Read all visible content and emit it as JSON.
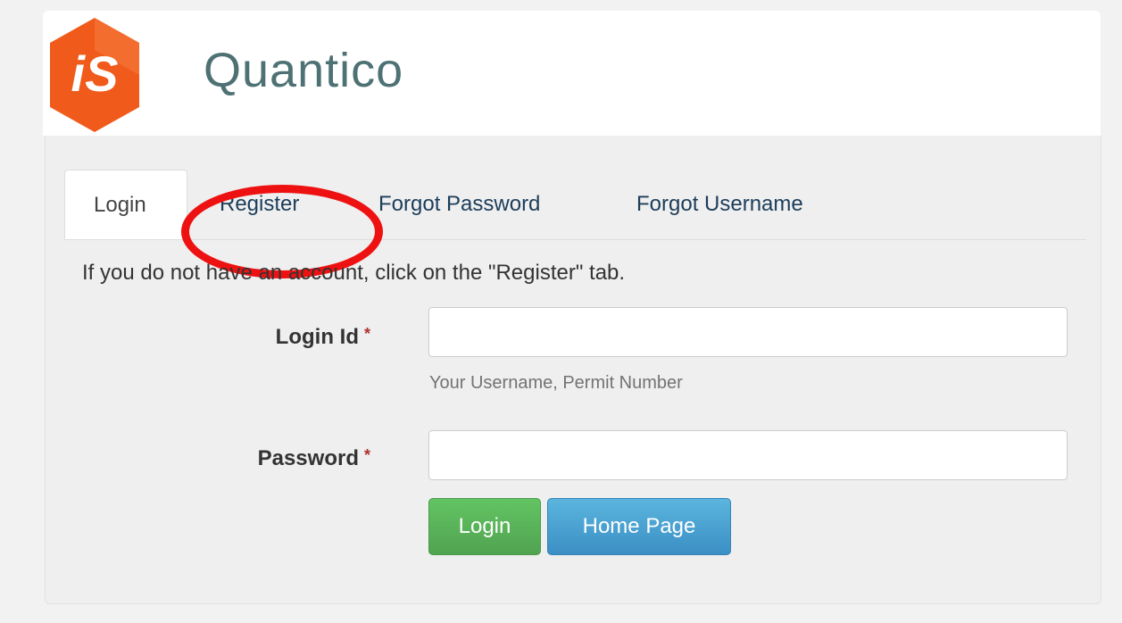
{
  "brand": {
    "logo_text": "iS",
    "name": "Quantico",
    "logo_color": "#f05a1a",
    "name_color": "#4e7174"
  },
  "tabs": [
    {
      "label": "Login",
      "active": true
    },
    {
      "label": "Register",
      "active": false,
      "highlighted": true
    },
    {
      "label": "Forgot Password",
      "active": false
    },
    {
      "label": "Forgot Username",
      "active": false
    }
  ],
  "form": {
    "info": "If you do not have an account, click on the \"Register\" tab.",
    "login_id": {
      "label": "Login Id",
      "required_mark": "*",
      "value": "",
      "help": "Your Username, Permit Number"
    },
    "password": {
      "label": "Password",
      "required_mark": "*",
      "value": ""
    },
    "buttons": {
      "login": "Login",
      "home": "Home Page"
    }
  },
  "colors": {
    "highlight": "#ee1111",
    "login_button": "#5cb85c",
    "home_button": "#4aa3d6"
  }
}
